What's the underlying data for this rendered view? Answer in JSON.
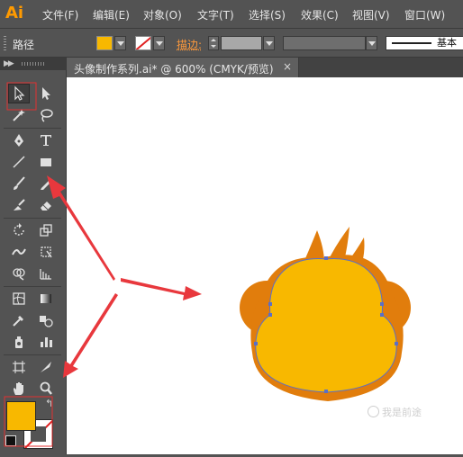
{
  "app": {
    "logo": "Ai"
  },
  "menu": [
    "文件(F)",
    "编辑(E)",
    "对象(O)",
    "文字(T)",
    "选择(S)",
    "效果(C)",
    "视图(V)",
    "窗口(W)"
  ],
  "control_bar": {
    "selection_label": "路径",
    "fill_color": "#f8b800",
    "stroke_label": "描边:",
    "brush_label": "基本"
  },
  "tools_panel": {
    "collapse_icon": "double-chevron-icon",
    "fill_color": "#f8b800",
    "stroke_color": "none"
  },
  "document": {
    "tab_title": "头像制作系列.ai* @ 600% (CMYK/预览)",
    "close_icon": "×"
  },
  "artwork": {
    "colors": {
      "face": "#f8b800",
      "head": "#e17d0c",
      "path": "#5a6fc8",
      "arrow": "#e8383d"
    }
  },
  "watermark": {
    "text": "我是前途"
  }
}
